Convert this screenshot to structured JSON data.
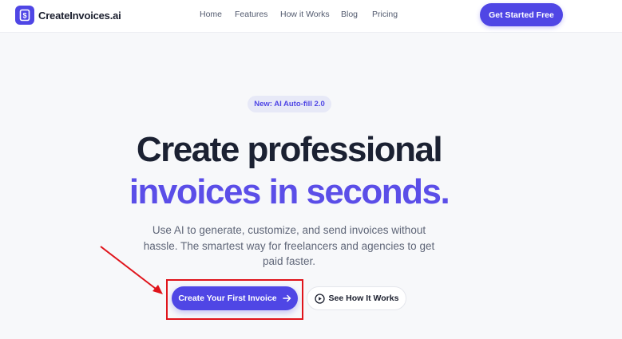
{
  "header": {
    "logo_text": "CreateInvoices.ai",
    "logo_icon": "dollar-document-icon",
    "nav": [
      {
        "label": "Home"
      },
      {
        "label": "Features"
      },
      {
        "label": "How it Works"
      },
      {
        "label": "Blog"
      },
      {
        "label": "Pricing"
      }
    ],
    "cta_label": "Get Started Free"
  },
  "hero": {
    "badge": "New: AI Auto-fill 2.0",
    "title_line1": "Create professional",
    "title_line2": "invoices in seconds.",
    "subtitle": "Use AI to generate, customize, and send invoices without hassle. The smartest way for freelancers and agencies to get paid faster.",
    "primary_button": "Create Your First Invoice",
    "primary_icon": "arrow-right-icon",
    "secondary_button": "See How It Works",
    "secondary_icon": "play-circle-icon"
  },
  "colors": {
    "brand": "#4f46e5",
    "title_dark": "#1b2132",
    "title_accent": "#5b4ee8",
    "annotation": "#e0141b",
    "background": "#f7f8fa"
  }
}
